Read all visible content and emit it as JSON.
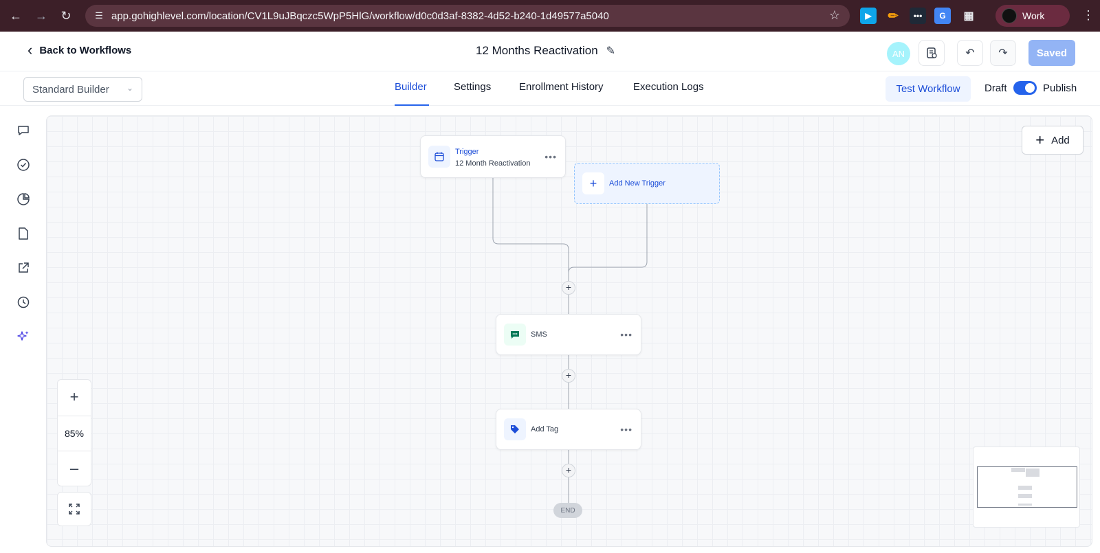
{
  "browser": {
    "url": "app.gohighlevel.com/location/CV1L9uJBqczc5WpP5HlG/workflow/d0c0d3af-8382-4d52-b240-1d49577a5040",
    "profile_label": "Work",
    "chrome_color": "#3c1f28"
  },
  "header": {
    "back_label": "Back to Workflows",
    "workflow_title": "12 Months Reactivation",
    "avatar_initials": "AN",
    "saved_label": "Saved"
  },
  "tabbar": {
    "builder_select": "Standard Builder",
    "tabs": [
      {
        "label": "Builder",
        "active": true
      },
      {
        "label": "Settings",
        "active": false
      },
      {
        "label": "Enrollment History",
        "active": false
      },
      {
        "label": "Execution Logs",
        "active": false
      }
    ],
    "test_label": "Test Workflow",
    "draft_label": "Draft",
    "publish_label": "Publish",
    "toggle_on": true
  },
  "sidebar": {
    "icons": [
      "chat-icon",
      "check-circle-icon",
      "pie-chart-icon",
      "document-icon",
      "external-link-icon",
      "history-icon",
      "sparkles-icon"
    ]
  },
  "canvas": {
    "add_label": "Add",
    "trigger": {
      "title": "Trigger",
      "subtitle": "12 Month Reactivation"
    },
    "add_trigger_label": "Add New Trigger",
    "actions": [
      {
        "label": "SMS",
        "icon": "sms-icon"
      },
      {
        "label": "Add Tag",
        "icon": "tag-icon"
      }
    ],
    "end_label": "END",
    "zoom_level": "85%"
  },
  "colors": {
    "accent": "#2563eb",
    "saved_button": "#93b4f5",
    "sms_icon": "#047857",
    "tag_icon": "#1d4ed8"
  }
}
